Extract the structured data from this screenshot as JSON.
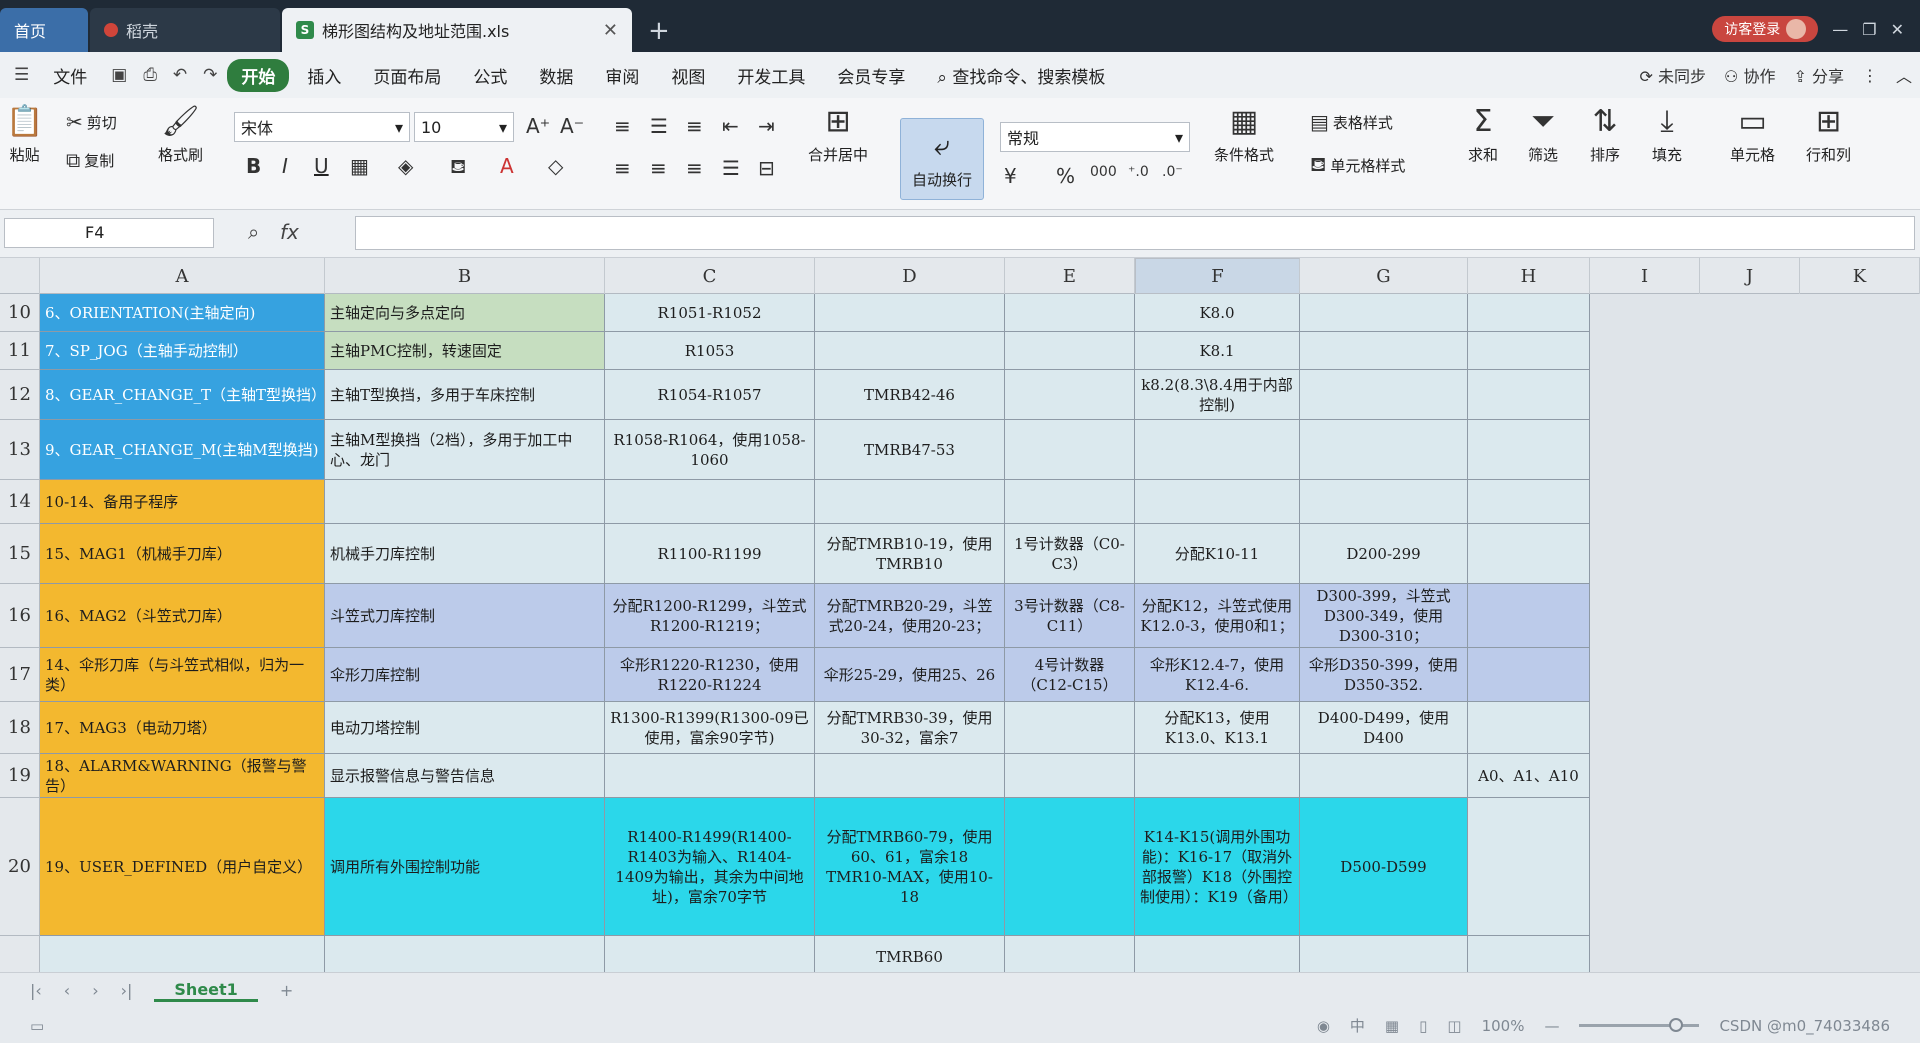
{
  "tabs": {
    "home": "首页",
    "other": "稻壳",
    "active": "梯形图结构及地址范围.xls",
    "close": "✕",
    "plus": "+"
  },
  "titlebar_right": {
    "login": "访客登录"
  },
  "menus": {
    "file": "文件",
    "items": [
      "开始",
      "插入",
      "页面布局",
      "公式",
      "数据",
      "审阅",
      "视图",
      "开发工具",
      "会员专享"
    ],
    "active_index": 0,
    "search": "查找命令、搜索模板",
    "unsynced": "未同步",
    "collab": "协作",
    "share": "分享"
  },
  "ribbon": {
    "paste": "粘贴",
    "cut": "剪切",
    "copy": "复制",
    "format_painter": "格式刷",
    "font_name": "宋体",
    "font_size": "10",
    "merge": "合并居中",
    "wrap": "自动换行",
    "number_format": "常规",
    "cond_format": "条件格式",
    "table_style": "表格样式",
    "cell_style": "单元格样式",
    "sum": "求和",
    "filter": "筛选",
    "sort": "排序",
    "fill": "填充",
    "cell": "单元格",
    "rowcol": "行和列",
    "bold": "B",
    "italic": "I",
    "underline": "U",
    "currency": "¥",
    "percent": "%",
    "thousands": "000"
  },
  "formula_bar": {
    "name_box": "F4",
    "fx": "fx",
    "content": ""
  },
  "columns": [
    "A",
    "B",
    "C",
    "D",
    "E",
    "F",
    "G",
    "H",
    "I",
    "J",
    "K"
  ],
  "selected_column": "F",
  "rows": [
    {
      "num": "10",
      "a": "6、ORIENTATION(主轴定向)",
      "b": "主轴定向与多点定向",
      "c": "R1051-R1052",
      "d": "",
      "e": "",
      "f": "K8.0",
      "g": "",
      "h": ""
    },
    {
      "num": "11",
      "a": "7、SP_JOG（主轴手动控制）",
      "b": "主轴PMC控制，转速固定",
      "c": "R1053",
      "d": "",
      "e": "",
      "f": "K8.1",
      "g": "",
      "h": ""
    },
    {
      "num": "12",
      "a": "8、GEAR_CHANGE_T（主轴T型换挡）",
      "b": "主轴T型换挡，多用于车床控制",
      "c": "R1054-R1057",
      "d": "TMRB42-46",
      "e": "",
      "f": "k8.2(8.3\\8.4用于内部控制)",
      "g": "",
      "h": ""
    },
    {
      "num": "13",
      "a": "9、GEAR_CHANGE_M(主轴M型换挡)",
      "b": "主轴M型换挡（2档），多用于加工中心、龙门",
      "c": "R1058-R1064，使用1058-1060",
      "d": "TMRB47-53",
      "e": "",
      "f": "",
      "g": "",
      "h": ""
    },
    {
      "num": "14",
      "a": "10-14、备用子程序",
      "b": "",
      "c": "",
      "d": "",
      "e": "",
      "f": "",
      "g": "",
      "h": ""
    },
    {
      "num": "15",
      "a": "15、MAG1（机械手刀库）",
      "b": "机械手刀库控制",
      "c": "R1100-R1199",
      "d": "分配TMRB10-19，使用TMRB10",
      "e": "1号计数器（C0-C3）",
      "f": "分配K10-11",
      "g": "D200-299",
      "h": ""
    },
    {
      "num": "16",
      "a": "16、MAG2（斗笠式刀库）",
      "b": "斗笠式刀库控制",
      "c": "分配R1200-R1299，斗笠式R1200-R1219；",
      "d": "分配TMRB20-29，斗笠式20-24，使用20-23；",
      "e": "3号计数器（C8-C11）",
      "f": "分配K12，斗笠式使用K12.0-3，使用0和1；",
      "g": "D300-399，斗笠式D300-349，使用D300-310；",
      "h": ""
    },
    {
      "num": "17",
      "a": "14、伞形刀库（与斗笠式相似，归为一类）",
      "b": "伞形刀库控制",
      "c": "伞形R1220-R1230，使用R1220-R1224",
      "d": "伞形25-29，使用25、26",
      "e": "4号计数器（C12-C15）",
      "f": "伞形K12.4-7，使用K12.4-6.",
      "g": "伞形D350-399，使用D350-352.",
      "h": ""
    },
    {
      "num": "18",
      "a": "17、MAG3（电动刀塔）",
      "b": "电动刀塔控制",
      "c": "R1300-R1399(R1300-09已使用，富余90字节)",
      "d": "分配TMRB30-39，使用30-32，富余7",
      "e": "",
      "f": "分配K13，使用K13.0、K13.1",
      "g": "D400-D499，使用D400",
      "h": ""
    },
    {
      "num": "19",
      "a": "18、ALARM&WARNING（报警与警告）",
      "b": "显示报警信息与警告信息",
      "c": "",
      "d": "",
      "e": "",
      "f": "",
      "g": "",
      "h": "A0、A1、A10"
    },
    {
      "num": "20",
      "a": "19、USER_DEFINED（用户自定义）",
      "b": "调用所有外围控制功能",
      "c": "R1400-R1499(R1400-R1403为输入、R1404-1409为输出，其余为中间地址)，富余70字节",
      "d": "分配TMRB60-79，使用60、61，富余18 TMR10-MAX，使用10-18",
      "e": "",
      "f": "K14-K15(调用外围功能)：K16-17（取消外部报警）K18（外围控制使用）：K19（备用）",
      "g": "D500-D599",
      "h": ""
    },
    {
      "num": "",
      "a": "",
      "b": "",
      "c": "",
      "d": "TMRB60",
      "e": "",
      "f": "",
      "g": "",
      "h": ""
    }
  ],
  "colors": {
    "orange": "#f3b82f",
    "blue": "#36a2e0",
    "cyan": "#2bd7ea",
    "lavender": "#bccbea",
    "green": "#c6dec0",
    "light": "#dbe9ee"
  },
  "sheet": {
    "name": "Sheet1",
    "add": "+"
  },
  "status": {
    "zoom": "100%",
    "watermark": "CSDN @m0_74033486"
  }
}
